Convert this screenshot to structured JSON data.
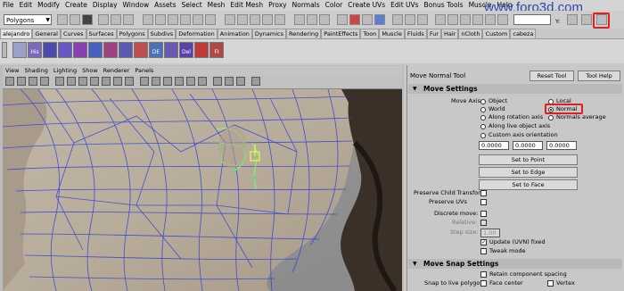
{
  "menu": [
    "File",
    "Edit",
    "Modify",
    "Create",
    "Display",
    "Window",
    "Assets",
    "Select",
    "Mesh",
    "Edit Mesh",
    "Proxy",
    "Normals",
    "Color",
    "Create UVs",
    "Edit UVs",
    "Bonus Tools",
    "Muscle",
    "Help"
  ],
  "watermark": "www.foro3d.com",
  "status": {
    "menu_set": "Polygons",
    "y_label": "Y:"
  },
  "shelf_tabs": [
    "alejandro",
    "General",
    "Curves",
    "Surfaces",
    "Polygons",
    "Subdivs",
    "Deformation",
    "Animation",
    "Dynamics",
    "Rendering",
    "PaintEffects",
    "Toon",
    "Muscle",
    "Fluids",
    "Fur",
    "Hair",
    "nCloth",
    "Custom",
    "cabeza"
  ],
  "shelf_icon_labels": [
    "His",
    "DE",
    "Del",
    "FI"
  ],
  "viewport_menu": [
    "View",
    "Shading",
    "Lighting",
    "Show",
    "Renderer",
    "Panels"
  ],
  "tool": {
    "title": "Move Normal Tool",
    "reset_label": "Reset Tool",
    "help_label": "Tool Help",
    "move_settings_header": "Move Settings",
    "move_axis_label": "Move Axis:",
    "axis_left": [
      "Object",
      "World",
      "Along rotation axis",
      "Along live object axis",
      "Custom axis orientation"
    ],
    "axis_right": [
      "Local",
      "Normal",
      "Normals average"
    ],
    "selected_axis": "Normal",
    "custom_axis_values": [
      "0.0000",
      "0.0000",
      "0.0000"
    ],
    "set_to_point": "Set to Point",
    "set_to_edge": "Set to Edge",
    "set_to_face": "Set to Face",
    "preserve_child_transform": "Preserve Child Transform",
    "preserve_uvs": "Preserve UVs",
    "discrete_move": "Discrete move:",
    "relative": "Relative:",
    "step_size_label": "Step size:",
    "step_size_value": "1.00",
    "update_uvn": "Update (UVN) fixed",
    "tweak_mode": "Tweak mode",
    "snap_header": "Move Snap Settings",
    "retain_spacing": "Retain component spacing",
    "snap_to_live": "Snap to live polygon:",
    "face_center": "Face center",
    "vertex": "Vertex"
  }
}
